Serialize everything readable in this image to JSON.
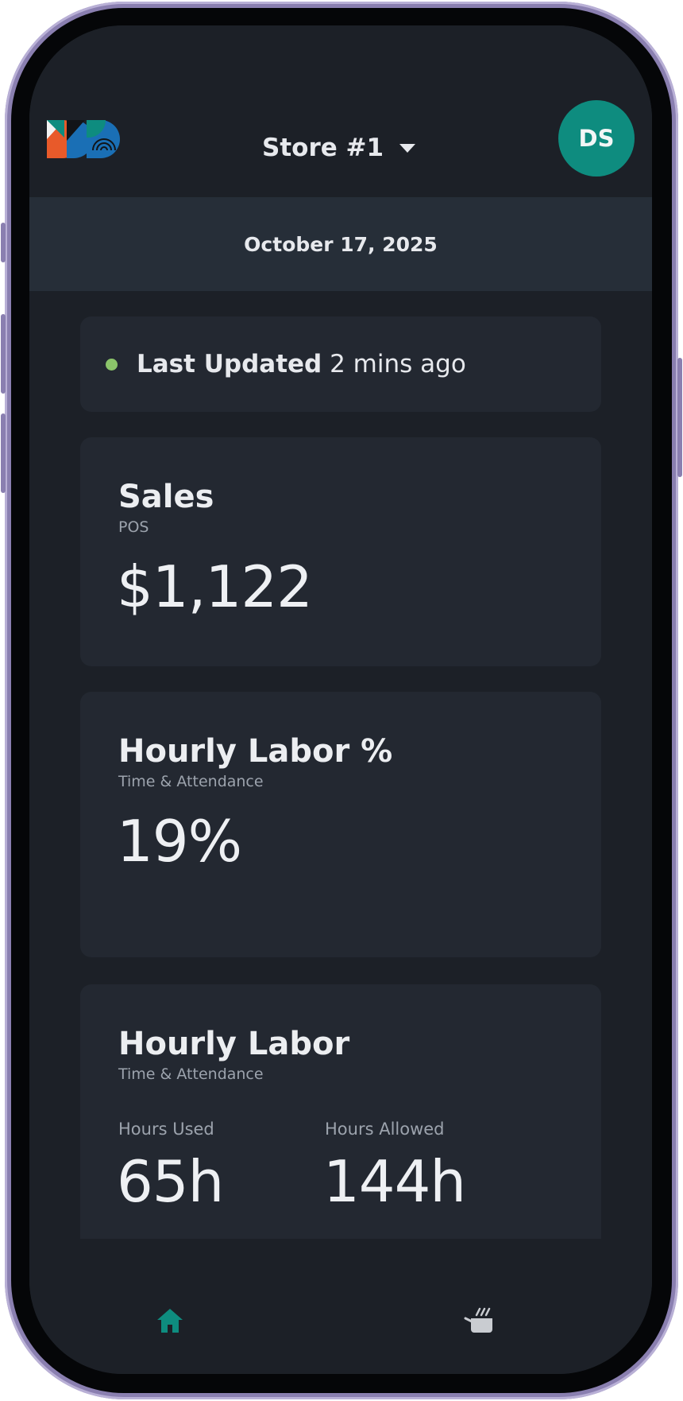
{
  "header": {
    "store_label": "Store #1",
    "avatar_initials": "DS"
  },
  "date_bar": {
    "date": "October 17, 2025"
  },
  "status": {
    "label": "Last Updated",
    "time_ago": "2 mins ago",
    "dot_color": "#8bc46a"
  },
  "cards": {
    "sales": {
      "title": "Sales",
      "source": "POS",
      "value": "$1,122"
    },
    "labor_pct": {
      "title": "Hourly Labor %",
      "source": "Time & Attendance",
      "value": "19%"
    },
    "labor": {
      "title": "Hourly Labor",
      "source": "Time & Attendance",
      "used_label": "Hours Used",
      "used_value": "65h",
      "allowed_label": "Hours Allowed",
      "allowed_value": "144h"
    }
  },
  "bottom_nav": {
    "items": [
      {
        "icon": "home-icon",
        "active": true
      },
      {
        "icon": "cooking-pot-icon",
        "active": false
      }
    ]
  },
  "colors": {
    "accent": "#0e8c7f",
    "background": "#1c2027",
    "card": "#232831"
  }
}
